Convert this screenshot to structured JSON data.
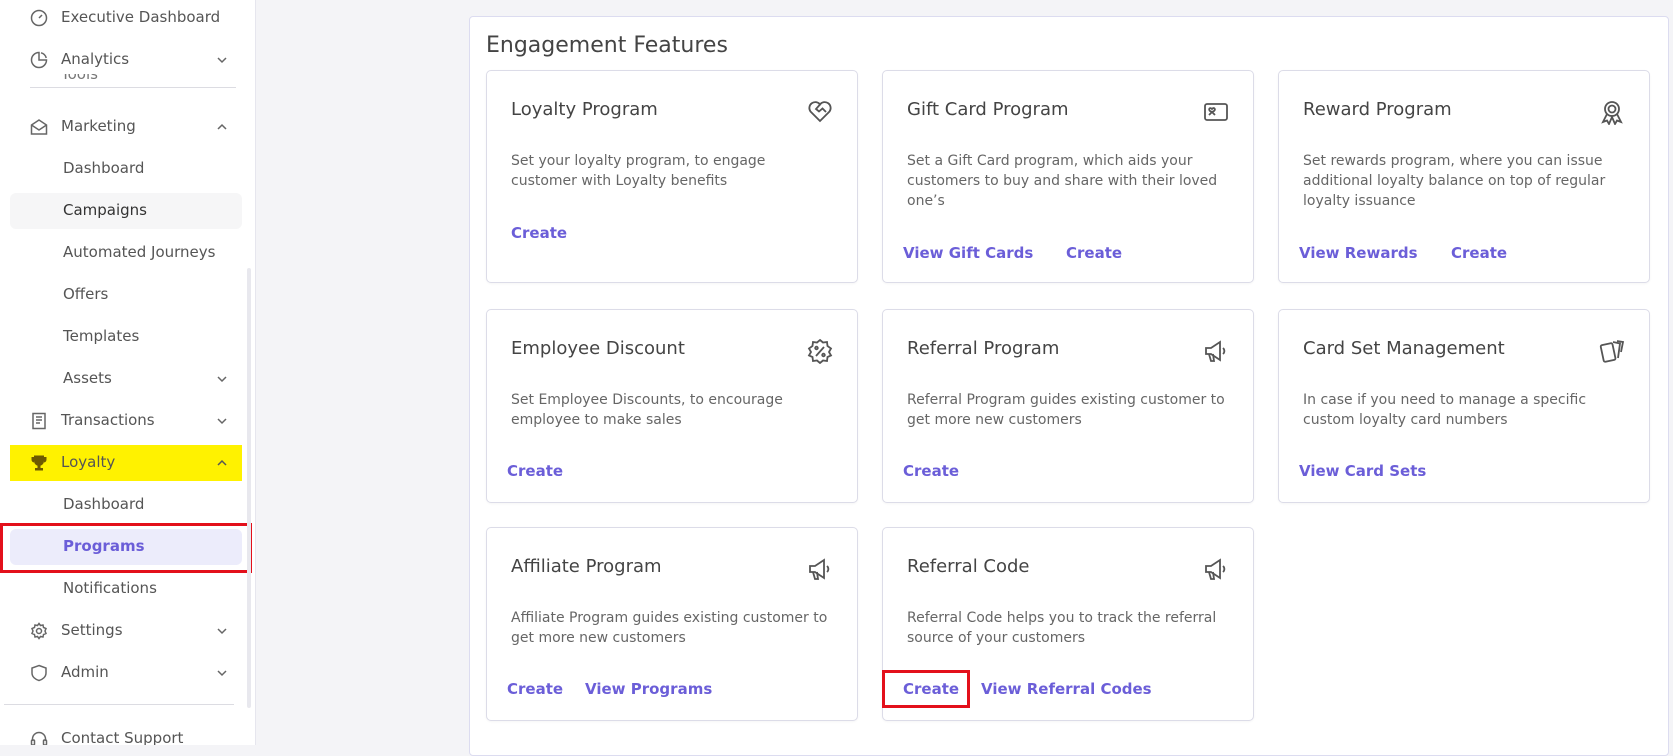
{
  "sidebar": {
    "executive_dashboard": "Executive Dashboard",
    "analytics": "Analytics",
    "tools_partial": "Tools",
    "marketing": "Marketing",
    "marketing_items": [
      "Dashboard",
      "Campaigns",
      "Automated Journeys",
      "Offers",
      "Templates",
      "Assets"
    ],
    "transactions": "Transactions",
    "loyalty": "Loyalty",
    "loyalty_items": [
      "Dashboard",
      "Programs",
      "Notifications"
    ],
    "settings": "Settings",
    "admin": "Admin",
    "contact_support": "Contact Support"
  },
  "main": {
    "title": "Engagement Features",
    "cards": [
      {
        "title": "Loyalty Program",
        "desc": "Set your loyalty program, to engage customer with Loyalty benefits",
        "icon": "heart-handshake-icon",
        "links": [
          "Create"
        ]
      },
      {
        "title": "Gift Card Program",
        "desc": "Set a Gift Card program, which aids your customers to buy and share with their loved one’s",
        "icon": "gift-card-icon",
        "links": [
          "View Gift Cards",
          "Create"
        ]
      },
      {
        "title": "Reward Program",
        "desc": "Set rewards program, where you can issue additional loyalty balance on top of regular loyalty issuance",
        "icon": "award-ribbon-icon",
        "links": [
          "View Rewards",
          "Create"
        ]
      },
      {
        "title": "Employee Discount",
        "desc": "Set Employee Discounts, to encourage employee to make sales",
        "icon": "discount-badge-icon",
        "links": [
          "Create"
        ]
      },
      {
        "title": "Referral Program",
        "desc": "Referral Program guides existing customer to get more new customers",
        "icon": "megaphone-icon",
        "links": [
          "Create"
        ]
      },
      {
        "title": "Card Set Management",
        "desc": "In case if you need to manage a specific custom loyalty card numbers",
        "icon": "cards-icon",
        "links": [
          "View Card Sets"
        ]
      },
      {
        "title": "Affiliate Program",
        "desc": "Affiliate Program guides existing customer to get more new customers",
        "icon": "megaphone-icon",
        "links": [
          "Create",
          "View Programs"
        ]
      },
      {
        "title": "Referral Code",
        "desc": "Referral Code helps you to track the referral source of your customers",
        "icon": "megaphone-icon",
        "links": [
          "Create",
          "View Referral Codes"
        ]
      }
    ]
  },
  "colors": {
    "accent": "#6b5ed8",
    "highlight": "#fff200",
    "annotation_red": "#e3101b"
  }
}
